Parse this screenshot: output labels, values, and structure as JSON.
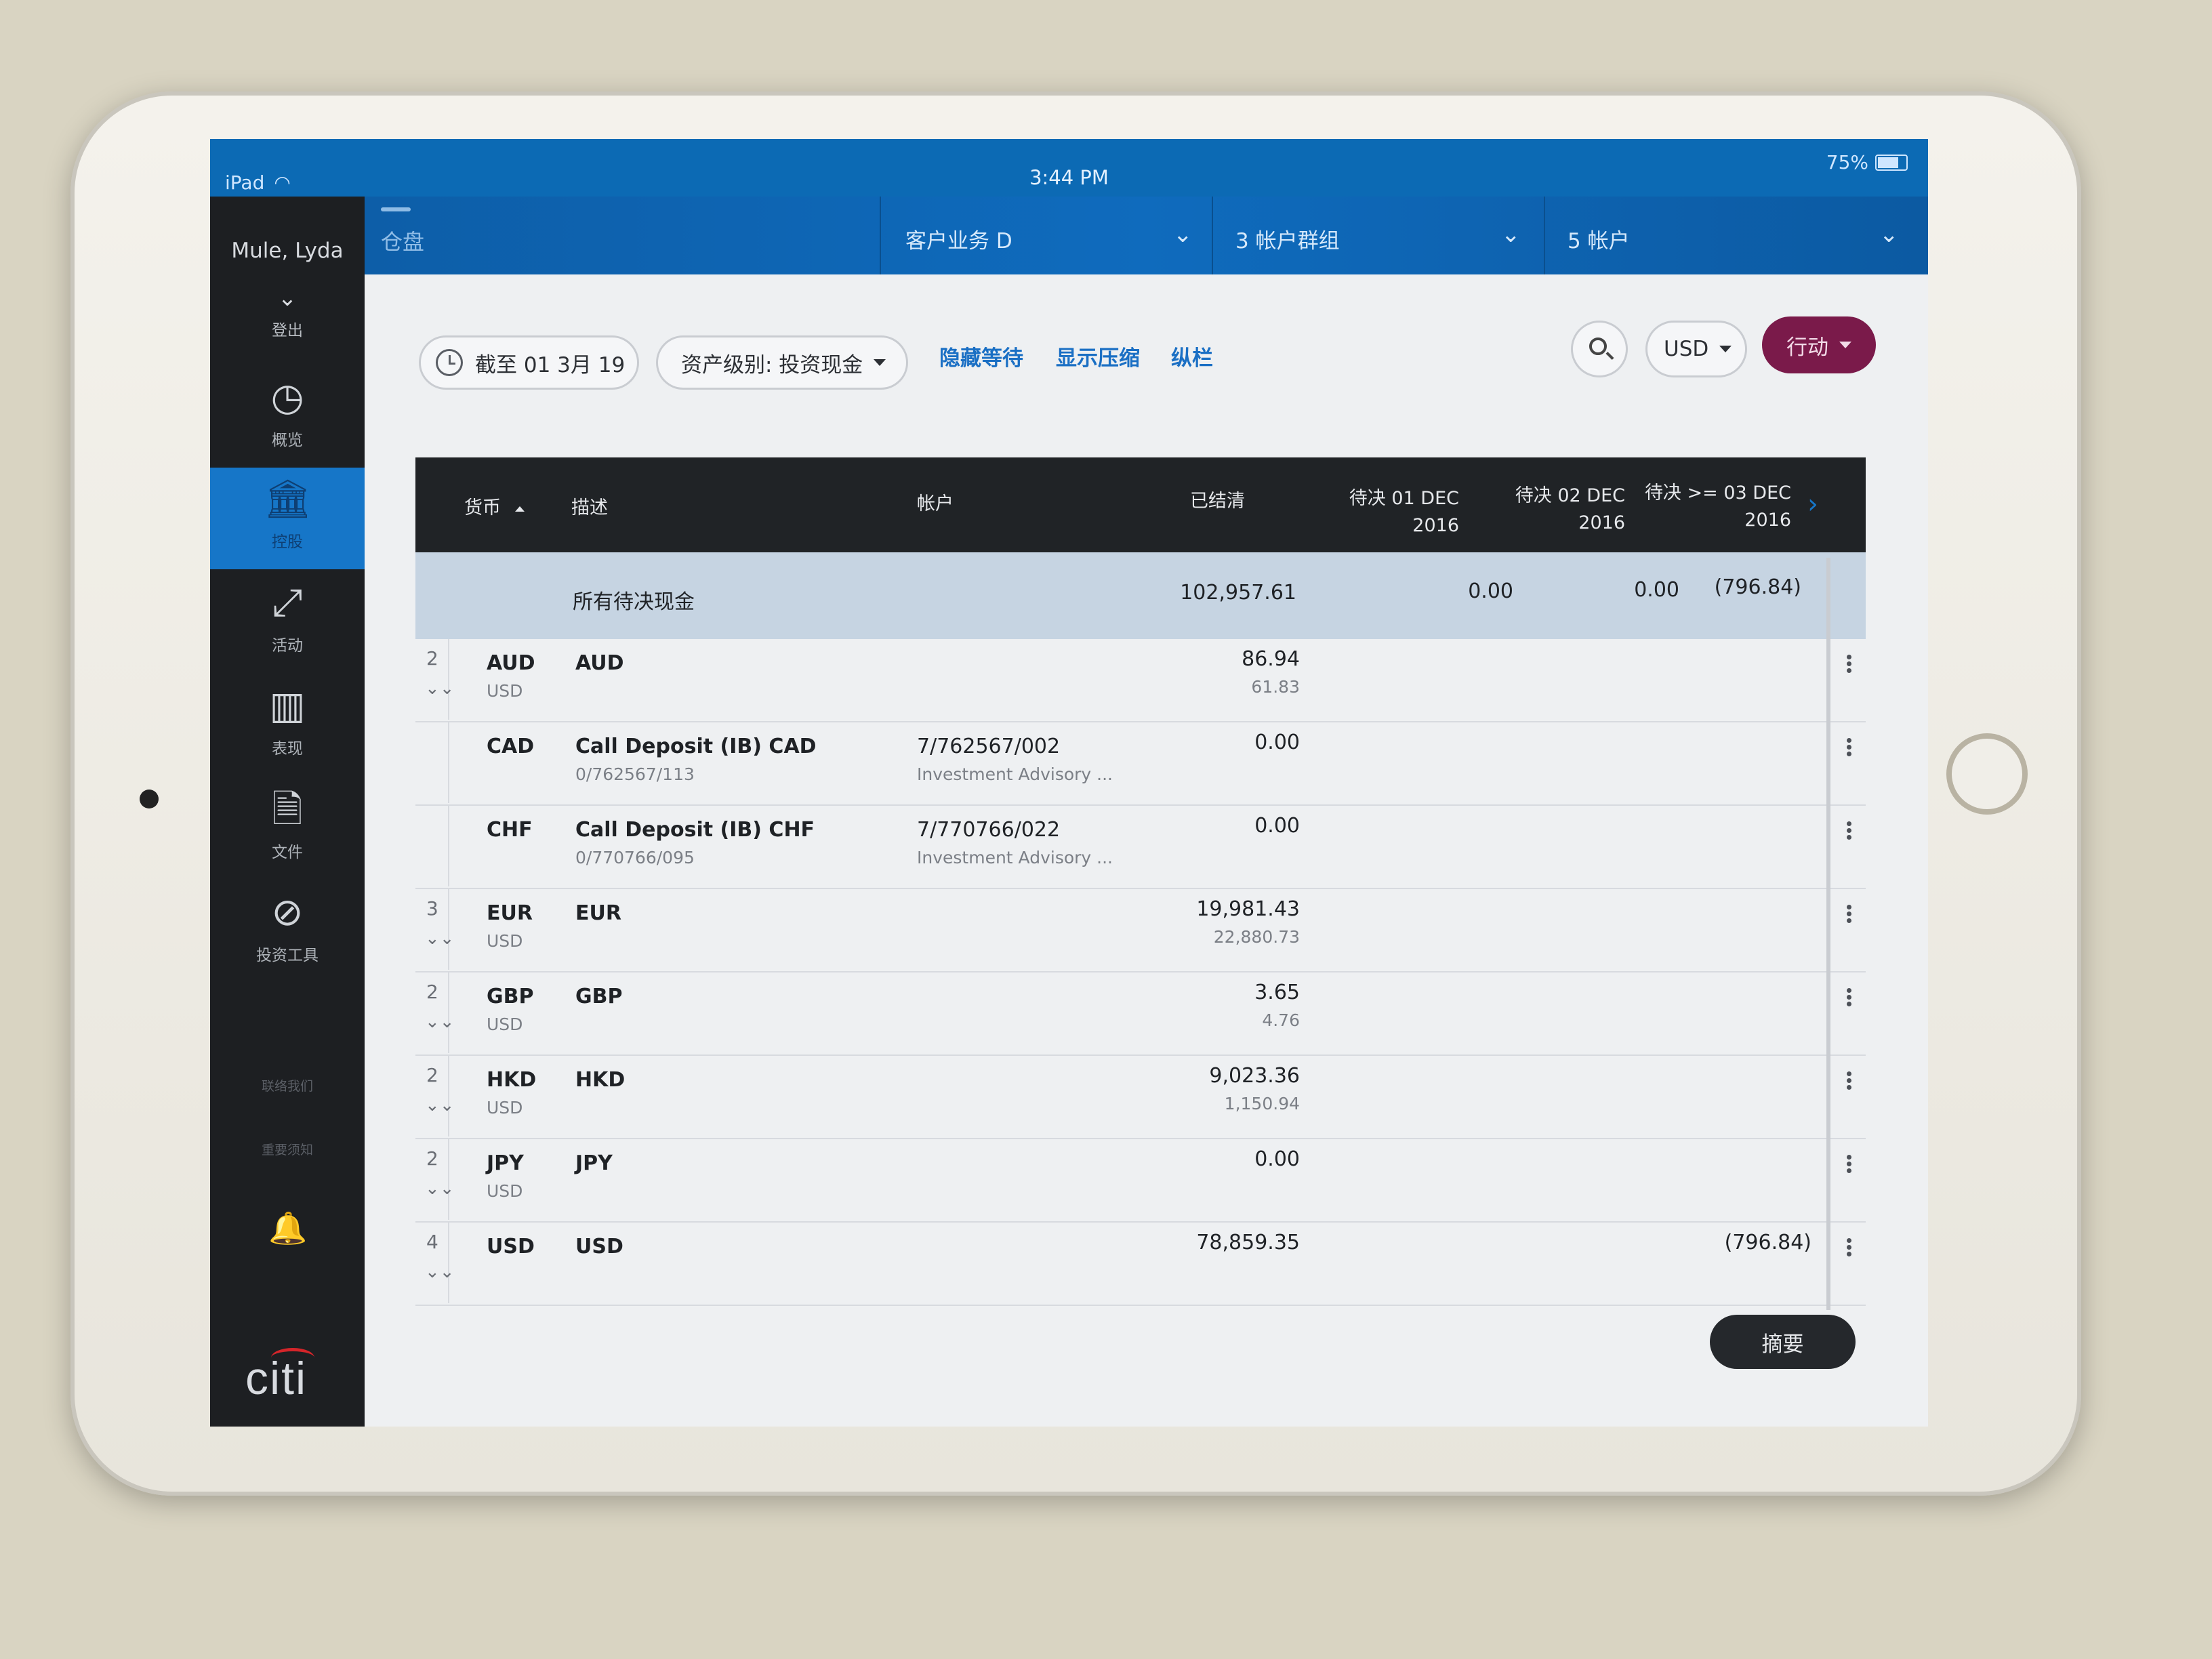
{
  "status": {
    "device": "iPad",
    "time": "3:44 PM",
    "battery": "75%"
  },
  "sidebar": {
    "user": "Mule, Lyda",
    "logout": "登出",
    "items": [
      {
        "label": "概览",
        "icon": "gauge-icon"
      },
      {
        "label": "控股",
        "icon": "bank-icon"
      },
      {
        "label": "活动",
        "icon": "arrows-icon"
      },
      {
        "label": "表现",
        "icon": "bar-chart-icon"
      },
      {
        "label": "文件",
        "icon": "document-lock-icon"
      },
      {
        "label": "投资工具",
        "icon": "compass-icon"
      }
    ],
    "contact": "联络我们",
    "notice": "重要须知",
    "brand": "citi"
  },
  "topbar": {
    "title": "仓盘",
    "business": "客户业务 D",
    "group": "3 帐户群组",
    "accounts": "5 帐户"
  },
  "toolbar": {
    "date": "截至 01 3月 19",
    "asset_class": "资产级别: 投资现金",
    "hide_pending": "隐藏等待",
    "show_compressed": "显示压缩",
    "columns": "纵栏",
    "currency": "USD",
    "action": "行动"
  },
  "table": {
    "headers": {
      "currency": "货币",
      "description": "描述",
      "account": "帐户",
      "settled": "已结清",
      "pending1_a": "待决 01 DEC",
      "pending1_b": "2016",
      "pending2_a": "待决 02 DEC",
      "pending2_b": "2016",
      "pending3_a": "待决 >= 03 DEC",
      "pending3_b": "2016"
    },
    "summary": {
      "label": "所有待决现金",
      "settled": "102,957.61",
      "pending1": "0.00",
      "pending2": "0.00",
      "pending3": "(796.84)"
    },
    "rows": [
      {
        "count": "2",
        "cur": "AUD",
        "cur_sub": "USD",
        "desc": "AUD",
        "desc_sub": "",
        "acct": "",
        "acct_sub": "",
        "settled": "86.94",
        "settled_sub": "61.83",
        "pending3": ""
      },
      {
        "count": "",
        "cur": "CAD",
        "cur_sub": "",
        "desc": "Call Deposit (IB) CAD",
        "desc_sub": "0/762567/113",
        "acct": "7/762567/002",
        "acct_sub": "Investment Advisory ...",
        "settled": "0.00",
        "settled_sub": "",
        "pending3": ""
      },
      {
        "count": "",
        "cur": "CHF",
        "cur_sub": "",
        "desc": "Call Deposit (IB) CHF",
        "desc_sub": "0/770766/095",
        "acct": "7/770766/022",
        "acct_sub": "Investment Advisory ...",
        "settled": "0.00",
        "settled_sub": "",
        "pending3": ""
      },
      {
        "count": "3",
        "cur": "EUR",
        "cur_sub": "USD",
        "desc": "EUR",
        "desc_sub": "",
        "acct": "",
        "acct_sub": "",
        "settled": "19,981.43",
        "settled_sub": "22,880.73",
        "pending3": ""
      },
      {
        "count": "2",
        "cur": "GBP",
        "cur_sub": "USD",
        "desc": "GBP",
        "desc_sub": "",
        "acct": "",
        "acct_sub": "",
        "settled": "3.65",
        "settled_sub": "4.76",
        "pending3": ""
      },
      {
        "count": "2",
        "cur": "HKD",
        "cur_sub": "USD",
        "desc": "HKD",
        "desc_sub": "",
        "acct": "",
        "acct_sub": "",
        "settled": "9,023.36",
        "settled_sub": "1,150.94",
        "pending3": ""
      },
      {
        "count": "2",
        "cur": "JPY",
        "cur_sub": "USD",
        "desc": "JPY",
        "desc_sub": "",
        "acct": "",
        "acct_sub": "",
        "settled": "0.00",
        "settled_sub": "",
        "pending3": ""
      },
      {
        "count": "4",
        "cur": "USD",
        "cur_sub": "",
        "desc": "USD",
        "desc_sub": "",
        "acct": "",
        "acct_sub": "",
        "settled": "78,859.35",
        "settled_sub": "",
        "pending3": "(796.84)"
      }
    ]
  },
  "summary_button": "摘要",
  "colors": {
    "header_blue": "#0f6bbd",
    "sidebar_dark": "#1d1f22",
    "action_purple": "#7a1a4a",
    "link_blue": "#1a6fc4"
  }
}
